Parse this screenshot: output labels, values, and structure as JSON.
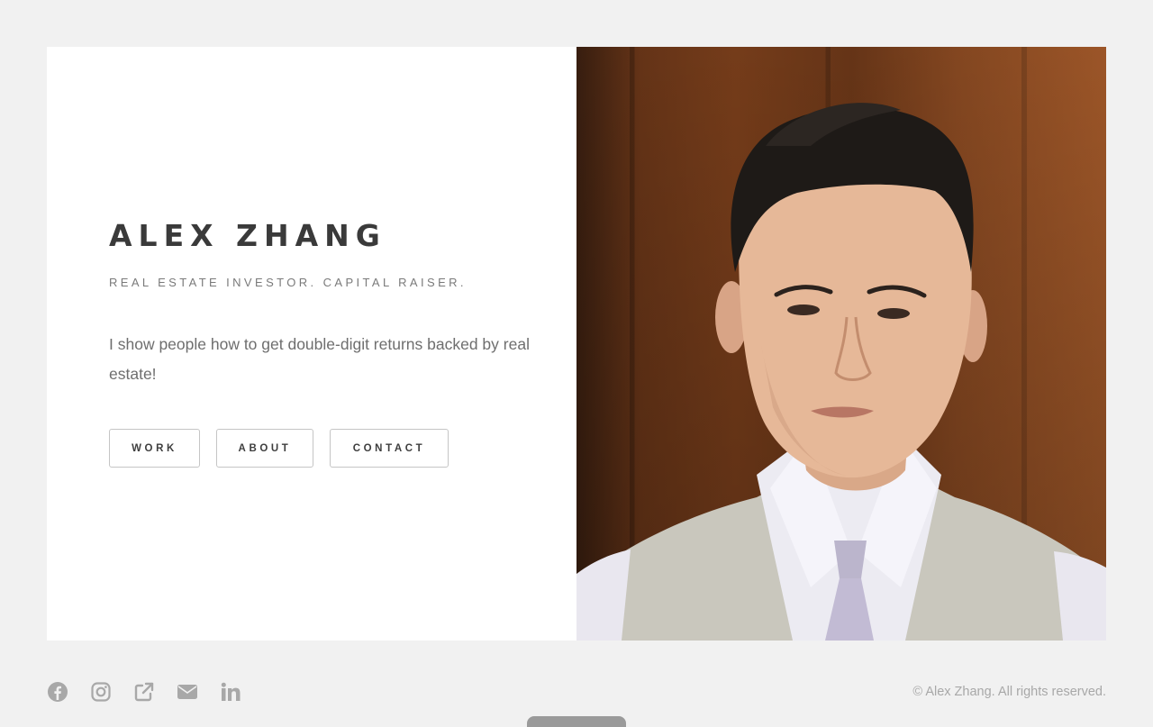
{
  "profile": {
    "name": "ALEX ZHANG",
    "tagline": "REAL ESTATE INVESTOR. CAPITAL RAISER.",
    "bio": "I show people how to get double-digit returns backed by real estate!"
  },
  "nav": {
    "work": "WORK",
    "about": "ABOUT",
    "contact": "CONTACT"
  },
  "footer": {
    "social_icons": [
      "facebook-icon",
      "instagram-icon",
      "external-link-icon",
      "envelope-icon",
      "linkedin-icon"
    ],
    "copyright": "© Alex Zhang. All rights reserved."
  },
  "colors": {
    "background": "#f1f1f1",
    "card": "#ffffff",
    "heading": "#3a3a3a",
    "icon": "#a8a8a8"
  }
}
